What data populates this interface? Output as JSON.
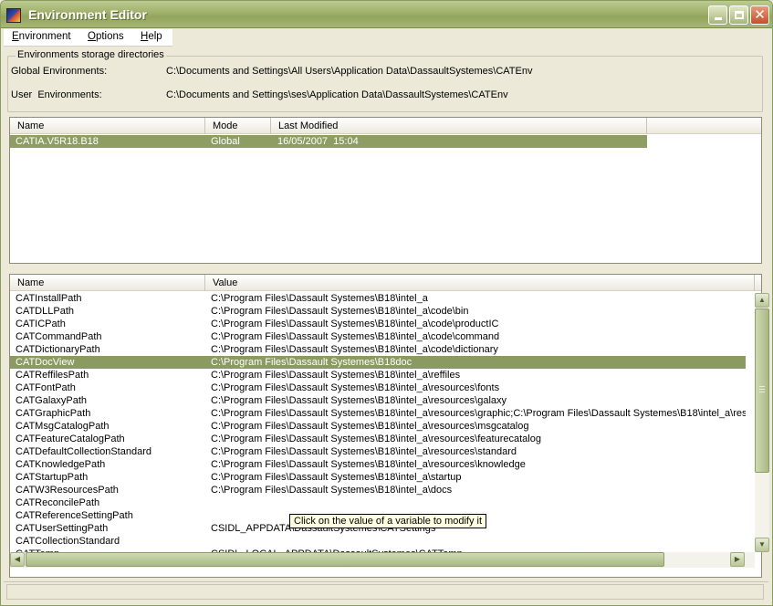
{
  "window": {
    "title": "Environment Editor"
  },
  "menu": [
    {
      "label": "Environment"
    },
    {
      "label": "Options"
    },
    {
      "label": "Help"
    }
  ],
  "storage": {
    "group_title": "Environments storage directories",
    "global_label": "Global Environments:",
    "global_value": "C:\\Documents and Settings\\All Users\\Application Data\\DassaultSystemes\\CATEnv",
    "user_label": "User  Environments:",
    "user_value": "C:\\Documents and Settings\\ses\\Application Data\\DassaultSystemes\\CATEnv"
  },
  "environments": {
    "columns": [
      "Name",
      "Mode",
      "Last Modified"
    ],
    "rows": [
      {
        "name": "CATIA.V5R18.B18",
        "mode": "Global",
        "modified": "16/05/2007  15:04"
      }
    ]
  },
  "variables": {
    "columns": [
      "Name",
      "Value"
    ],
    "rows": [
      {
        "name": "CATInstallPath",
        "value": "C:\\Program Files\\Dassault Systemes\\B18\\intel_a"
      },
      {
        "name": "CATDLLPath",
        "value": "C:\\Program Files\\Dassault Systemes\\B18\\intel_a\\code\\bin"
      },
      {
        "name": "CATICPath",
        "value": "C:\\Program Files\\Dassault Systemes\\B18\\intel_a\\code\\productIC"
      },
      {
        "name": "CATCommandPath",
        "value": "C:\\Program Files\\Dassault Systemes\\B18\\intel_a\\code\\command"
      },
      {
        "name": "CATDictionaryPath",
        "value": "C:\\Program Files\\Dassault Systemes\\B18\\intel_a\\code\\dictionary"
      },
      {
        "name": "CATDocView",
        "value": "C:\\Program Files\\Dassault Systemes\\B18doc"
      },
      {
        "name": "CATReffilesPath",
        "value": "C:\\Program Files\\Dassault Systemes\\B18\\intel_a\\reffiles"
      },
      {
        "name": "CATFontPath",
        "value": "C:\\Program Files\\Dassault Systemes\\B18\\intel_a\\resources\\fonts"
      },
      {
        "name": "CATGalaxyPath",
        "value": "C:\\Program Files\\Dassault Systemes\\B18\\intel_a\\resources\\galaxy"
      },
      {
        "name": "CATGraphicPath",
        "value": "C:\\Program Files\\Dassault Systemes\\B18\\intel_a\\resources\\graphic;C:\\Program Files\\Dassault Systemes\\B18\\intel_a\\resou"
      },
      {
        "name": "CATMsgCatalogPath",
        "value": "C:\\Program Files\\Dassault Systemes\\B18\\intel_a\\resources\\msgcatalog"
      },
      {
        "name": "CATFeatureCatalogPath",
        "value": "C:\\Program Files\\Dassault Systemes\\B18\\intel_a\\resources\\featurecatalog"
      },
      {
        "name": "CATDefaultCollectionStandard",
        "value": "C:\\Program Files\\Dassault Systemes\\B18\\intel_a\\resources\\standard"
      },
      {
        "name": "CATKnowledgePath",
        "value": "C:\\Program Files\\Dassault Systemes\\B18\\intel_a\\resources\\knowledge"
      },
      {
        "name": "CATStartupPath",
        "value": "C:\\Program Files\\Dassault Systemes\\B18\\intel_a\\startup"
      },
      {
        "name": "CATW3ResourcesPath",
        "value": "C:\\Program Files\\Dassault Systemes\\B18\\intel_a\\docs"
      },
      {
        "name": "CATReconcilePath",
        "value": ""
      },
      {
        "name": "CATReferenceSettingPath",
        "value": ""
      },
      {
        "name": "CATUserSettingPath",
        "value": "CSIDL_APPDATA\\DassaultSystemes\\CATSettings"
      },
      {
        "name": "CATCollectionStandard",
        "value": ""
      },
      {
        "name": "CATTemp",
        "value": "CSIDL_LOCAL_APPDATA\\DassaultSystemes\\CATTemp"
      }
    ]
  },
  "tooltip": "Click on the value of a variable to modify it",
  "icons": {
    "app": "catia-logo-icon",
    "scroll_up": "arrow-up-icon",
    "scroll_down": "arrow-down-icon",
    "scroll_left": "arrow-left-icon",
    "scroll_right": "arrow-right-icon"
  },
  "colors": {
    "title_bar": "#a2b46e",
    "selection": "#8d9d64",
    "window_bg": "#ece9d8"
  }
}
